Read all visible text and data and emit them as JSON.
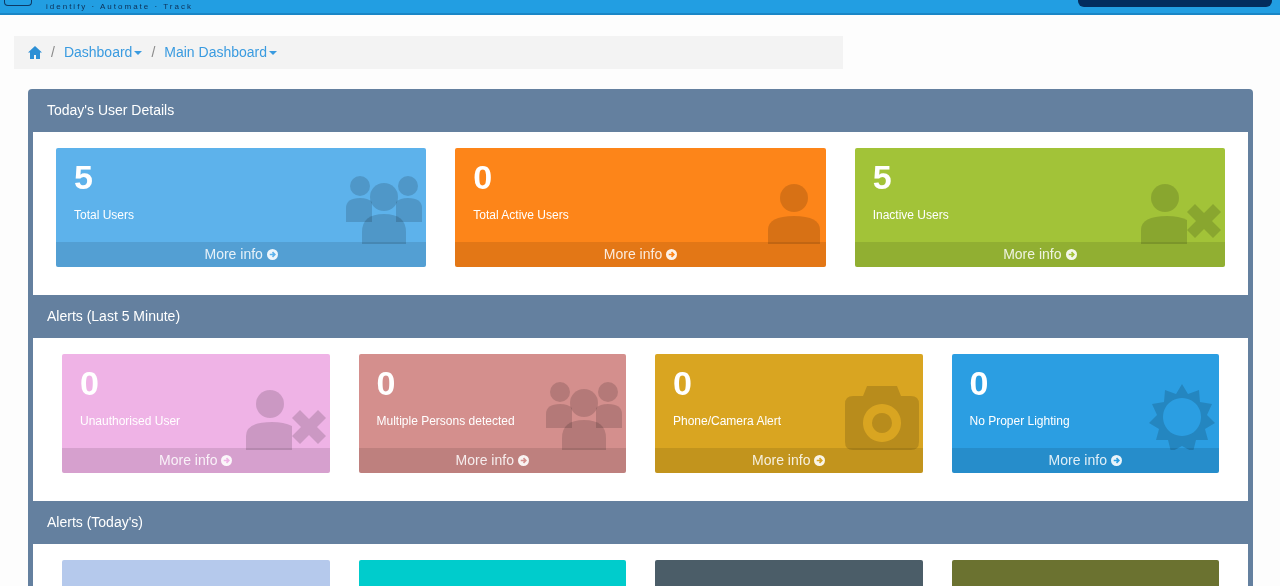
{
  "header": {
    "tagline": "identify · Automate · Track"
  },
  "breadcrumb": [
    {
      "kind": "home"
    },
    {
      "kind": "separator",
      "label": "/"
    },
    {
      "kind": "menu",
      "label": "Dashboard"
    },
    {
      "kind": "separator",
      "label": "/"
    },
    {
      "kind": "menu",
      "label": "Main Dashboard"
    }
  ],
  "sections": [
    {
      "title": "Today's User Details",
      "cards": [
        {
          "value": "5",
          "label": "Total Users",
          "link": "More info",
          "color": "#5db2eb",
          "kind": "users"
        },
        {
          "value": "0",
          "label": "Total Active Users",
          "link": "More info",
          "color": "#fd8519",
          "kind": "user"
        },
        {
          "value": "5",
          "label": "Inactive Users",
          "link": "More info",
          "color": "#a2c338",
          "kind": "user-x"
        }
      ]
    },
    {
      "title": "Alerts (Last 5 Minute)",
      "cards": [
        {
          "value": "0",
          "label": "Unauthorised User",
          "link": "More info",
          "color": "#efb3e6",
          "kind": "user-x"
        },
        {
          "value": "0",
          "label": "Multiple Persons detected",
          "link": "More info",
          "color": "#d48f8d",
          "kind": "users"
        },
        {
          "value": "0",
          "label": "Phone/Camera Alert",
          "link": "More info",
          "color": "#d9a521",
          "kind": "camera"
        },
        {
          "value": "0",
          "label": "No Proper Lighting",
          "link": "More info",
          "color": "#2b9ee2",
          "kind": "sun"
        }
      ]
    },
    {
      "title": "Alerts (Today's)",
      "cards": [
        {
          "color": "#b5c9ec"
        },
        {
          "color": "#00cccc"
        },
        {
          "color": "#4b5d68"
        },
        {
          "color": "#6b7230"
        }
      ]
    }
  ]
}
